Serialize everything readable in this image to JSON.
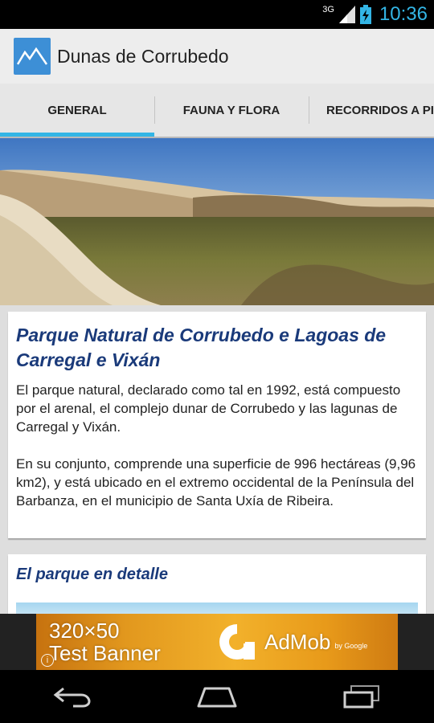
{
  "status_bar": {
    "network": "3G",
    "time": "10:36",
    "icons": [
      "signal-icon",
      "battery-icon"
    ],
    "clock_color": "#33b5e5"
  },
  "app": {
    "title": "Dunas de Corrubedo",
    "icon": "mountain-icon"
  },
  "tabs": [
    {
      "label": "GENERAL",
      "active": true
    },
    {
      "label": "FAUNA Y FLORA",
      "active": false
    },
    {
      "label": "RECORRIDOS A PI",
      "active": false
    }
  ],
  "accent_color": "#33b5e5",
  "main": {
    "card1": {
      "title": "Parque Natural de Corrubedo e Lagoas de Carregal e Vixán",
      "paragraph1": "El parque natural, declarado como tal en 1992, está compuesto por el arenal, el complejo dunar de Corrubedo y las lagunas de Carregal y Vixán.",
      "paragraph2": "En su conjunto, comprende una superficie de 996 hectáreas (9,96 km2), y está ubicado en el extremo occidental de la Península del Barbanza, en el municipio de Santa Uxía de Ribeira."
    },
    "card2": {
      "title": "El parque en detalle"
    }
  },
  "ad": {
    "text_line1": "320×50",
    "text_line2": "Test Banner",
    "brand": "AdMob",
    "by": "by Google"
  },
  "nav_bar": {
    "icons": [
      "back-icon",
      "home-icon",
      "recent-apps-icon"
    ]
  }
}
